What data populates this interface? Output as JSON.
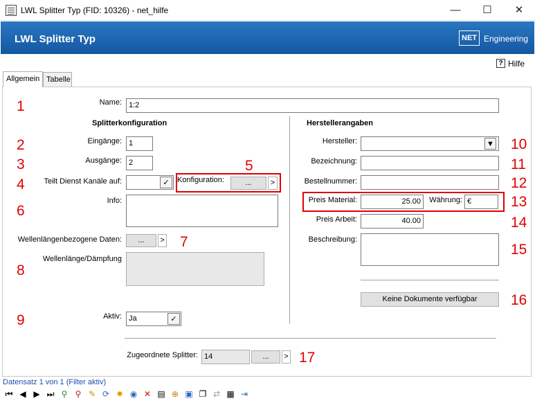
{
  "window": {
    "title": "LWL Splitter Typ (FID: 10326) - net_hilfe"
  },
  "header": {
    "title": "LWL Splitter Typ",
    "logo": "NET",
    "brand": "Engineering"
  },
  "help": {
    "label": "Hilfe",
    "glyph": "?"
  },
  "tabs": [
    {
      "label": "Allgemein"
    },
    {
      "label": "Tabelle"
    }
  ],
  "form": {
    "name": {
      "label": "Name:",
      "value": "1:2"
    },
    "splitter_heading": "Splitterkonfiguration",
    "hersteller_heading": "Herstellerangaben",
    "eingaenge": {
      "label": "Eingänge:",
      "value": "1"
    },
    "ausgaenge": {
      "label": "Ausgänge:",
      "value": "2"
    },
    "teilt": {
      "label": "Teilt Dienst Kanäle auf:",
      "value": ""
    },
    "konfiguration": {
      "label": "Konfiguration:",
      "btn": "...",
      "arrow": ">"
    },
    "info": {
      "label": "Info:",
      "value": ""
    },
    "wellen_daten": {
      "label": "Wellenlängenbezogene Daten:",
      "btn": "...",
      "arrow": ">"
    },
    "wellen_daempfung": {
      "label": "Wellenlänge/Dämpfung"
    },
    "aktiv": {
      "label": "Aktiv:",
      "value": "Ja"
    },
    "hersteller": {
      "label": "Hersteller:",
      "value": ""
    },
    "bezeichnung": {
      "label": "Bezeichnung:",
      "value": ""
    },
    "bestellnummer": {
      "label": "Bestellnummer:",
      "value": ""
    },
    "preis_material": {
      "label": "Preis Material:",
      "value": "25.00"
    },
    "waehrung": {
      "label": "Währung:",
      "value": "€"
    },
    "preis_arbeit": {
      "label": "Preis Arbeit:",
      "value": "40.00"
    },
    "beschreibung": {
      "label": "Beschreibung:",
      "value": ""
    },
    "dokumente_btn": "Keine Dokumente verfügbar",
    "zugeordnete": {
      "label": "Zugeordnete Splitter:",
      "value": "14",
      "btn": "...",
      "arrow": ">"
    }
  },
  "annotations": [
    "1",
    "2",
    "3",
    "4",
    "5",
    "6",
    "7",
    "8",
    "9",
    "10",
    "11",
    "12",
    "13",
    "14",
    "15",
    "16",
    "17"
  ],
  "status": {
    "text": "Datensatz 1 von 1 (Filter aktiv)"
  },
  "colors": {
    "header": "#1a63ad",
    "annotation": "#e00000"
  }
}
